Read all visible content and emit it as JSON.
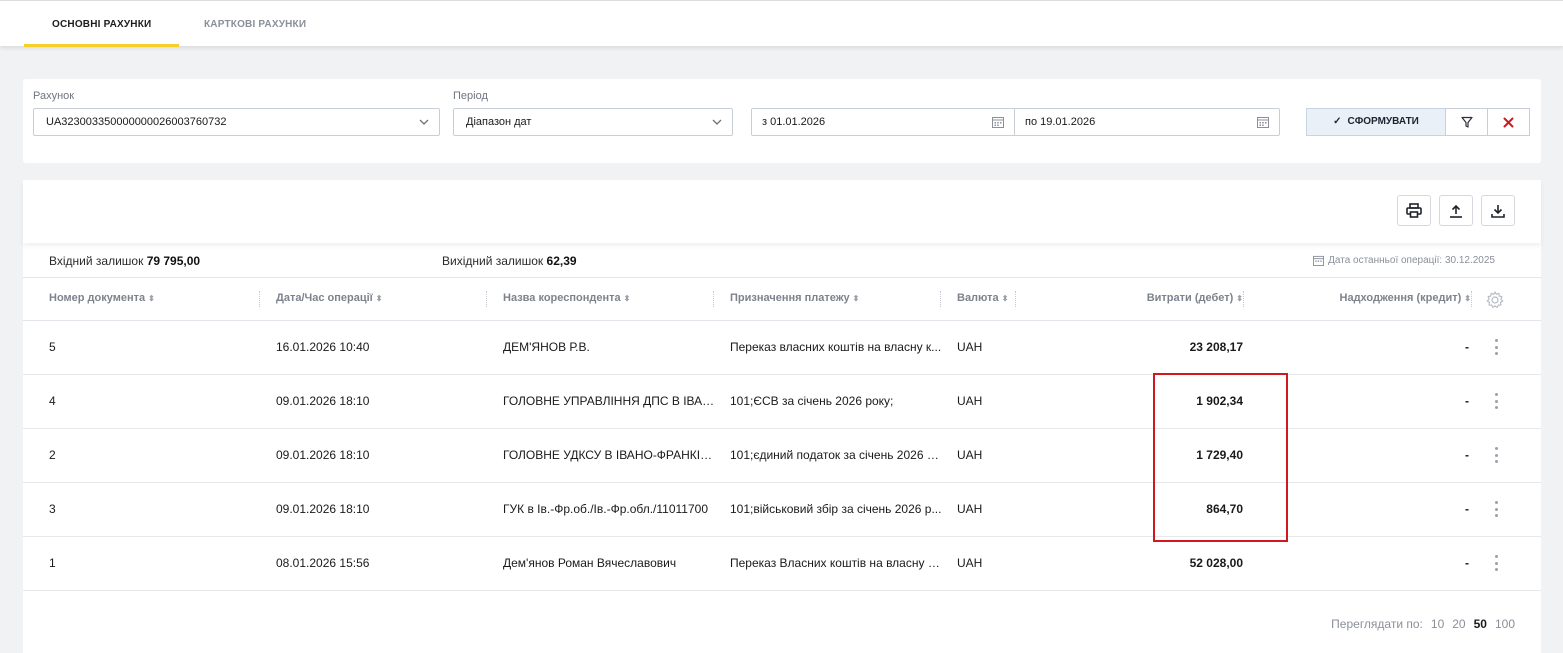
{
  "tabs": [
    {
      "label": "ОСНОВНІ РАХУНКИ",
      "active": true
    },
    {
      "label": "КАРТКОВІ РАХУНКИ",
      "active": false
    }
  ],
  "filters": {
    "account_label": "Рахунок",
    "account_value": "UA323003350000000026003760732",
    "period_label": "Період",
    "period_value": "Діапазон дат",
    "date_from": "з 01.01.2026",
    "date_to": "по 19.01.2026",
    "submit_label": "СФОРМУВАТИ"
  },
  "balances": {
    "opening_label": "Вхідний залишок",
    "opening_value": "79 795,00",
    "closing_label": "Вихідний залишок",
    "closing_value": "62,39",
    "last_operation": "Дата останньої операції: 30.12.2025"
  },
  "columns": [
    "Номер документа",
    "Дата/Час операції",
    "Назва кореспондента",
    "Призначення платежу",
    "Валюта",
    "Витрати (дебет)",
    "Надходження (кредит)"
  ],
  "rows": [
    {
      "doc": "5",
      "datetime": "16.01.2026 10:40",
      "correspondent": "ДЕМ'ЯНОВ Р.В.",
      "purpose": "Переказ власних коштів на власну к...",
      "currency": "UAH",
      "debit": "23 208,17",
      "credit": "-"
    },
    {
      "doc": "4",
      "datetime": "09.01.2026 18:10",
      "correspondent": "ГОЛОВНЕ УПРАВЛІННЯ ДПС В ІВАН...",
      "purpose": "101;ЄСВ за січень 2026 року;",
      "currency": "UAH",
      "debit": "1 902,34",
      "credit": "-"
    },
    {
      "doc": "2",
      "datetime": "09.01.2026 18:10",
      "correspondent": "ГОЛОВНЕ УДКСУ В ІВАНО-ФРАНКІВС...",
      "purpose": "101;єдиний податок за січень 2026 р...",
      "currency": "UAH",
      "debit": "1 729,40",
      "credit": "-"
    },
    {
      "doc": "3",
      "datetime": "09.01.2026 18:10",
      "correspondent": "ГУК в Ів.-Фр.об./Ів.-Фр.обл./11011700",
      "purpose": "101;військовий збір за січень 2026 р...",
      "currency": "UAH",
      "debit": "864,70",
      "credit": "-"
    },
    {
      "doc": "1",
      "datetime": "08.01.2026 15:56",
      "correspondent": "Дем'янов Роман Вячеславович",
      "purpose": "Переказ Власних коштів на власну к...",
      "currency": "UAH",
      "debit": "52 028,00",
      "credit": "-"
    }
  ],
  "pager": {
    "label": "Переглядати по:",
    "options": [
      "10",
      "20",
      "50",
      "100"
    ],
    "selected": "50"
  },
  "colors": {
    "accent_tab": "#f6cf2a",
    "highlight": "#d0191f",
    "clear_icon": "#d0191f"
  },
  "icons": [
    "chevron-down-icon",
    "calendar-icon",
    "checkmark-icon",
    "filter-icon",
    "close-icon",
    "print-icon",
    "upload-icon",
    "download-icon",
    "gear-icon",
    "kebab-menu-icon"
  ]
}
